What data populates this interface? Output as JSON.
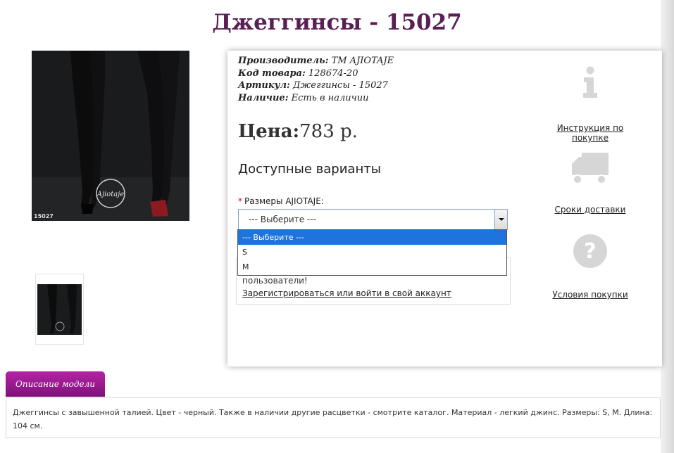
{
  "product": {
    "title": "Джеггинсы - 15027",
    "photo_code": "15027",
    "photo_logo_text": "Ajiotaje"
  },
  "info": {
    "manufacturer_label": "Производитель:",
    "manufacturer_value": "ТМ AJIOTAJE",
    "code_label": "Код товара:",
    "code_value": "128674-20",
    "article_label": "Артикул:",
    "article_value": "Джеггинсы - 15027",
    "availability_label": "Наличие:",
    "availability_value": "Есть в наличии"
  },
  "price": {
    "label": "Цена:",
    "value": "783 р."
  },
  "variants": {
    "heading": "Доступные варианты",
    "size_required_mark": "*",
    "size_label": "Размеры AJIOTAJE:",
    "select_value": "--- Выберите ---",
    "options": [
      "--- Выберите ---",
      "S",
      "M"
    ],
    "selected_index": 0
  },
  "registration": {
    "text": "пользователи!",
    "link": "Зарегистрироваться или войти в свой аккаунт"
  },
  "side_links": {
    "instruction": "Инструкция по покупке",
    "delivery": "Сроки доставки",
    "terms": "Условия покупки"
  },
  "description": {
    "tab_label": "Описание модели",
    "text": "Джеггинсы с завышенной талией. Цвет - черный. Также в наличии другие расцветки - смотрите каталог. Материал - легкий джинс. Размеры: S, M. Длина: 104 см."
  },
  "colors": {
    "title": "#5a1f54",
    "tab": "#a01c96",
    "dropdown_selected": "#1e73dc",
    "icon_gray": "#d6d6d6"
  }
}
